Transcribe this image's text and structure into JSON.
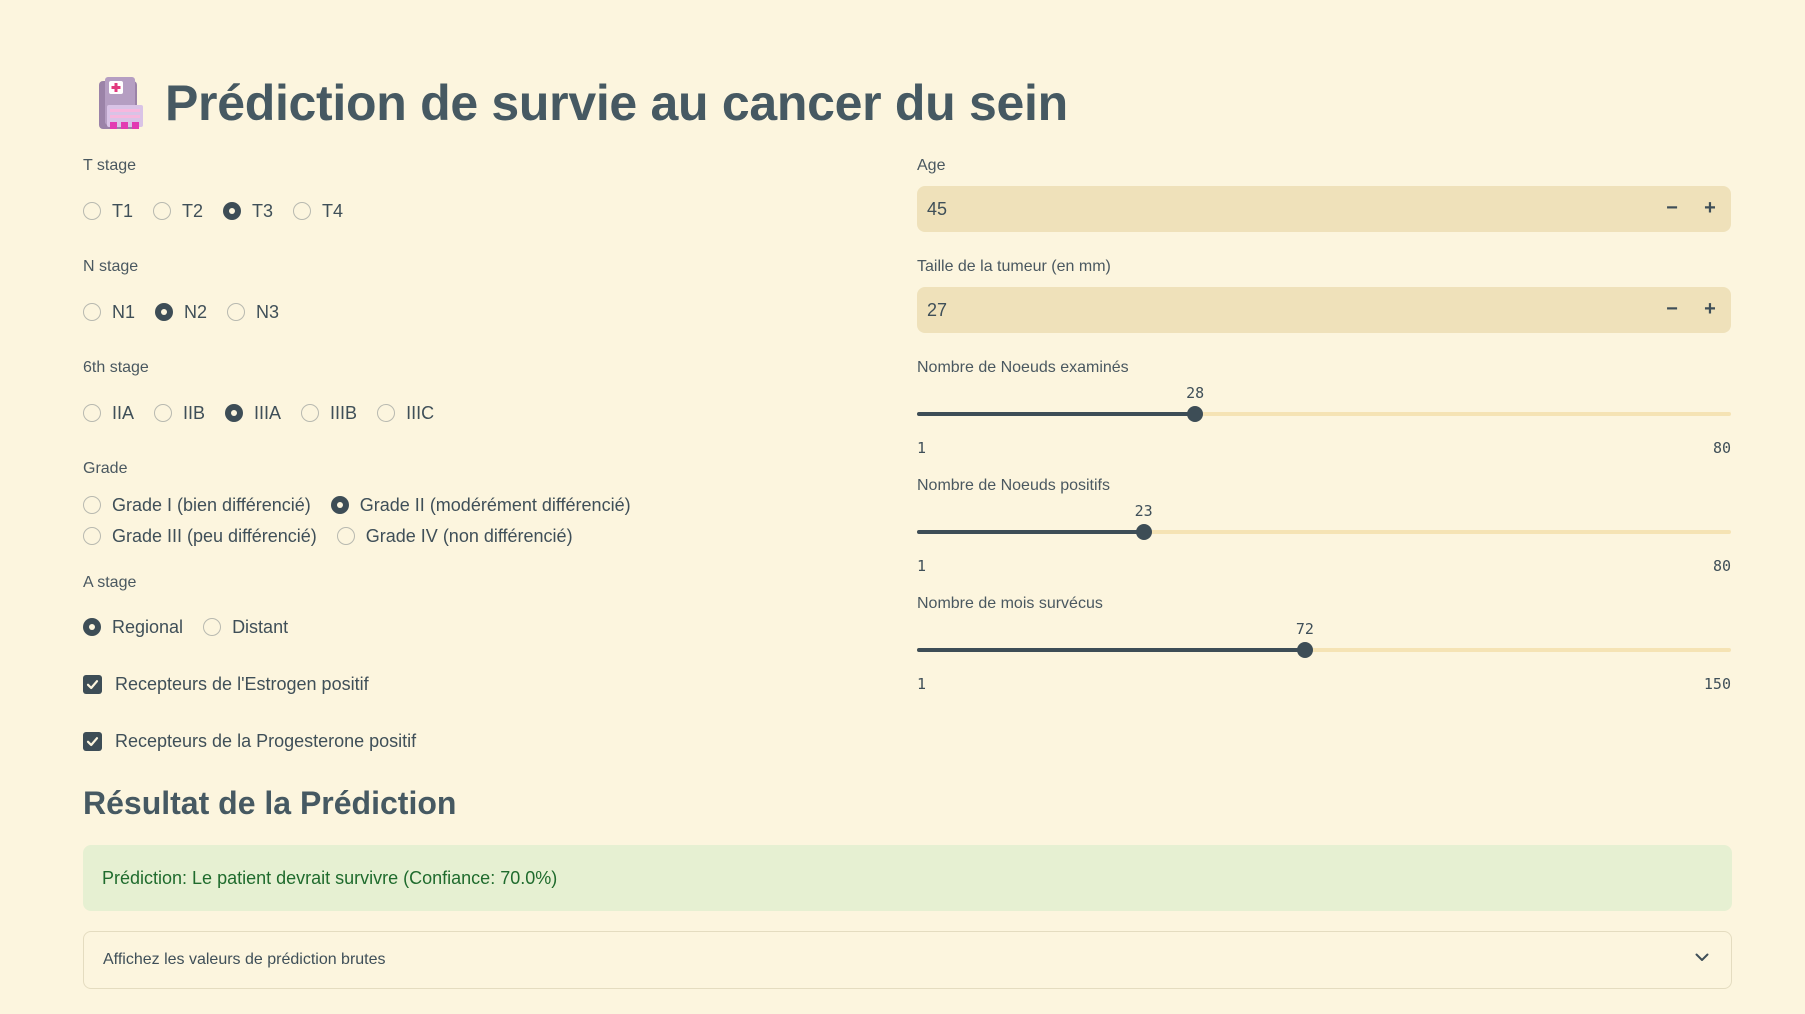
{
  "title": "Prédiction de survie au cancer du sein",
  "icon": "hospital-icon",
  "colors": {
    "background": "#fcf5de",
    "primary": "#3d4d56",
    "input_bg": "#efe1ba",
    "success_bg": "#e6f0d2",
    "success_text": "#1f6b2d"
  },
  "t_stage": {
    "label": "T stage",
    "options": [
      "T1",
      "T2",
      "T3",
      "T4"
    ],
    "selected": "T3"
  },
  "n_stage": {
    "label": "N stage",
    "options": [
      "N1",
      "N2",
      "N3"
    ],
    "selected": "N2"
  },
  "sixth_stage": {
    "label": "6th stage",
    "options": [
      "IIA",
      "IIB",
      "IIIA",
      "IIIB",
      "IIIC"
    ],
    "selected": "IIIA"
  },
  "grade": {
    "label": "Grade",
    "options": [
      "Grade I (bien différencié)",
      "Grade II (modérément différencié)",
      "Grade III (peu différencié)",
      "Grade IV (non différencié)"
    ],
    "selected": "Grade II (modérément différencié)"
  },
  "a_stage": {
    "label": "A stage",
    "options": [
      "Regional",
      "Distant"
    ],
    "selected": "Regional"
  },
  "estrogen": {
    "label": "Recepteurs de l'Estrogen positif",
    "checked": true
  },
  "progesterone": {
    "label": "Recepteurs de la Progesterone positif",
    "checked": true
  },
  "age": {
    "label": "Age",
    "value": "45",
    "minus": "−",
    "plus": "+"
  },
  "tumor_size": {
    "label": "Taille de la tumeur (en mm)",
    "value": "27",
    "minus": "−",
    "plus": "+"
  },
  "nodes_examined": {
    "label": "Nombre de Noeuds examinés",
    "value": 28,
    "min": 1,
    "max": 80
  },
  "nodes_positive": {
    "label": "Nombre de Noeuds positifs",
    "value": 23,
    "min": 1,
    "max": 80
  },
  "months_survived": {
    "label": "Nombre de mois survécus",
    "value": 72,
    "min": 1,
    "max": 150
  },
  "result": {
    "heading": "Résultat de la Prédiction",
    "message": "Prédiction: Le patient devrait survivre (Confiance: 70.0%)",
    "expander_label": "Affichez les valeurs de prédiction brutes"
  }
}
